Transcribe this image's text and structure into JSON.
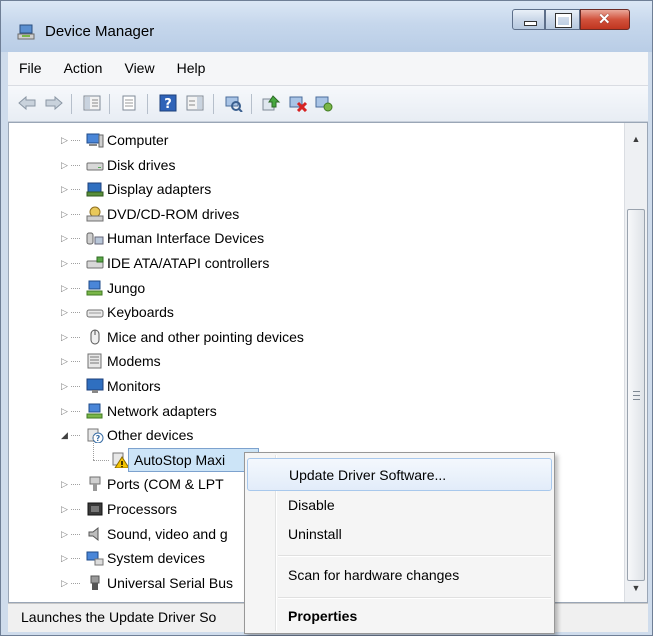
{
  "window": {
    "title": "Device Manager"
  },
  "menu": [
    "File",
    "Action",
    "View",
    "Help"
  ],
  "toolbar_icons": [
    "back-arrow-icon",
    "forward-arrow-icon",
    "show-hide-tree-icon",
    "properties-icon",
    "help-icon",
    "action-pane-icon",
    "scan-hardware-icon",
    "update-driver-icon",
    "uninstall-icon",
    "enable-device-icon"
  ],
  "tree": [
    {
      "label": "Computer",
      "icon": "computer-icon",
      "state": "collapsed"
    },
    {
      "label": "Disk drives",
      "icon": "disk-drive-icon",
      "state": "collapsed"
    },
    {
      "label": "Display adapters",
      "icon": "display-adapter-icon",
      "state": "collapsed"
    },
    {
      "label": "DVD/CD-ROM drives",
      "icon": "dvd-drive-icon",
      "state": "collapsed"
    },
    {
      "label": "Human Interface Devices",
      "icon": "hid-icon",
      "state": "collapsed"
    },
    {
      "label": "IDE ATA/ATAPI controllers",
      "icon": "ide-controller-icon",
      "state": "collapsed"
    },
    {
      "label": "Jungo",
      "icon": "network-icon",
      "state": "collapsed"
    },
    {
      "label": "Keyboards",
      "icon": "keyboard-icon",
      "state": "collapsed"
    },
    {
      "label": "Mice and other pointing devices",
      "icon": "mouse-icon",
      "state": "collapsed"
    },
    {
      "label": "Modems",
      "icon": "modem-icon",
      "state": "collapsed"
    },
    {
      "label": "Monitors",
      "icon": "monitor-icon",
      "state": "collapsed"
    },
    {
      "label": "Network adapters",
      "icon": "network-icon",
      "state": "collapsed"
    },
    {
      "label": "Other devices",
      "icon": "unknown-device-icon",
      "state": "expanded"
    },
    {
      "label": "AutoStop Maxi",
      "icon": "warning-device-icon",
      "state": "child",
      "selected": true
    },
    {
      "label": "Ports (COM & LPT",
      "icon": "port-icon",
      "state": "collapsed"
    },
    {
      "label": "Processors",
      "icon": "processor-icon",
      "state": "collapsed"
    },
    {
      "label": "Sound, video and g",
      "icon": "sound-icon",
      "state": "collapsed"
    },
    {
      "label": "System devices",
      "icon": "system-device-icon",
      "state": "collapsed"
    },
    {
      "label": "Universal Serial Bus",
      "icon": "usb-icon",
      "state": "collapsed"
    }
  ],
  "context_menu": {
    "update": "Update Driver Software...",
    "disable": "Disable",
    "uninstall": "Uninstall",
    "scan": "Scan for hardware changes",
    "properties": "Properties"
  },
  "status": "Launches the Update Driver So",
  "colors": {
    "selection": "#cce4f7",
    "warning": "#f5c400",
    "accent": "#3a6ea5"
  }
}
